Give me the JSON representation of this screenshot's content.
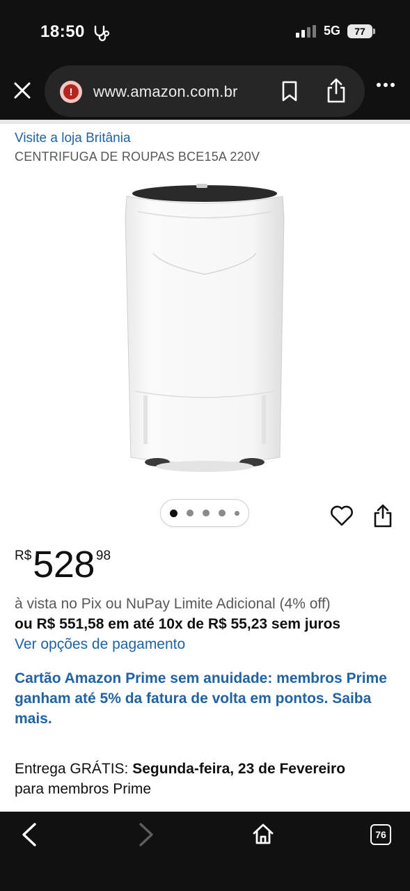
{
  "status_bar": {
    "time": "18:50",
    "network": "5G",
    "battery": "77"
  },
  "browser": {
    "url": "www.amazon.com.br",
    "tab_count": "76"
  },
  "product": {
    "store_link": "Visite a loja Britânia",
    "title": "CENTRIFUGA DE ROUPAS BCE15A 220V",
    "image_count": 5,
    "active_image": 1
  },
  "price": {
    "currency": "R$",
    "whole": "528",
    "fraction": "98",
    "pix_note": "à vista no Pix ou NuPay Limite Adicional (4% off)",
    "installments": "ou R$ 551,58 em até 10x de R$ 55,23 sem juros",
    "payment_options_link": "Ver opções de pagamento"
  },
  "card_offer": "Cartão Amazon Prime sem anuidade: membros Prime ganham até 5% da fatura de volta em pontos. Saiba mais.",
  "delivery": {
    "prefix": "Entrega GRÁTIS: ",
    "date": "Segunda-feira, 23 de Fevereiro",
    "suffix": "para membros Prime"
  },
  "colors": {
    "link": "#2162a1",
    "text": "#0f1111",
    "secondary_text": "#565959",
    "chrome": "#111111"
  }
}
